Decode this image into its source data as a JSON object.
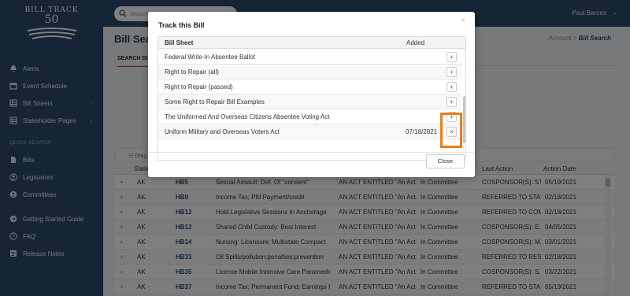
{
  "app": {
    "logo_top": "BILL TRACK",
    "logo_num": "50",
    "user_name": "Paul Barnes",
    "search_placeholder": "Search"
  },
  "sidebar": {
    "items": [
      {
        "label": "Alerts",
        "icon": "bell-icon"
      },
      {
        "label": "Event Schedule",
        "icon": "calendar-icon"
      },
      {
        "label": "Bill Sheets",
        "icon": "grid-icon",
        "chevron": "‹"
      },
      {
        "label": "Stakeholder Pages",
        "icon": "grid-icon",
        "chevron": "‹"
      }
    ],
    "quick_search_label": "QUICK SEARCH",
    "quick_items": [
      {
        "label": "Bills",
        "icon": "document-icon"
      },
      {
        "label": "Legislators",
        "icon": "person-icon"
      },
      {
        "label": "Committees",
        "icon": "group-icon"
      }
    ],
    "bottom_items": [
      {
        "label": "Getting Started Guide",
        "icon": "arrow-circle-icon"
      },
      {
        "label": "FAQ",
        "icon": "question-icon"
      },
      {
        "label": "Release Notes",
        "icon": "notes-icon"
      }
    ]
  },
  "page": {
    "title": "Bill Sea",
    "breadcrumb_parent": "Account",
    "breadcrumb_sep": " > ",
    "breadcrumb_current": "Bill Search",
    "tab_label": "SEARCH BIL",
    "group_bar_text": "Drag he"
  },
  "grid": {
    "headers": {
      "state": "State",
      "last_action": "Last Action",
      "action_date": "Action Date"
    },
    "rows": [
      {
        "state": "AK",
        "bill": "HB5",
        "title": "Sexual Assault; Def. Of \"consent\"",
        "desc": "AN ACT ENTITLED \"An Act r...",
        "status": "In Committee",
        "last": "COSPONSOR(S): ST...",
        "date": "05/19/2021"
      },
      {
        "state": "AK",
        "bill": "HB9",
        "title": "Income Tax; Pfd Payment/credit",
        "desc": "AN ACT ENTITLED \"An Act r...",
        "status": "In Committee",
        "last": "REFERRED TO STA...",
        "date": "02/18/2021"
      },
      {
        "state": "AK",
        "bill": "HB12",
        "title": "Hold Legislative Sessions In Anchorage",
        "desc": "AN ACT ENTITLED \"An Act r...",
        "status": "In Committee",
        "last": "REFERRED TO COM...",
        "date": "02/18/2021"
      },
      {
        "state": "AK",
        "bill": "HB13",
        "title": "Shared Child Custody: Best Interest",
        "desc": "AN ACT ENTITLED \"An Act r...",
        "status": "In Committee",
        "last": "COSPONSOR(S): E...",
        "date": "04/05/2021"
      },
      {
        "state": "AK",
        "bill": "HB14",
        "title": "Nursing: Licensure; Multistate Compact",
        "desc": "AN ACT ENTITLED \"An Act r...",
        "status": "In Committee",
        "last": "COSPONSOR(S): M...",
        "date": "03/01/2021"
      },
      {
        "state": "AK",
        "bill": "HB33",
        "title": "Oil Spills/pollution;penalties;prevention",
        "desc": "AN ACT ENTITLED \"An Act r...",
        "status": "In Committee",
        "last": "REFERRED TO RES...",
        "date": "02/18/2021"
      },
      {
        "state": "AK",
        "bill": "HB35",
        "title": "License Mobile Intensive Care Paramedics",
        "desc": "AN ACT ENTITLED \"An Act r...",
        "status": "In Committee",
        "last": "COSPONSOR(S): S...",
        "date": "03/22/2021"
      },
      {
        "state": "AK",
        "bill": "HB37",
        "title": "Income Tax; Permanent Fund; Earnings Res.",
        "desc": "AN ACT ENTITLED \"An Act r...",
        "status": "In Committee",
        "last": "REFERRED TO STA...",
        "date": "05/19/2021"
      }
    ]
  },
  "modal": {
    "title": "Track this Bill",
    "col_sheet": "Bill Sheet",
    "col_added": "Added",
    "rows": [
      {
        "name": "Federal Write-In Absentee Ballot",
        "added": "",
        "action": "+"
      },
      {
        "name": "Right to Repair (all)",
        "added": "",
        "action": "+"
      },
      {
        "name": "Right to Repair (passed)",
        "added": "",
        "action": "+"
      },
      {
        "name": "Some Right to Repair Bill Examples",
        "added": "",
        "action": "+"
      },
      {
        "name": "The Uniformed And Overseas Citizens Absentee Voting Act",
        "added": "",
        "action": "+"
      },
      {
        "name": "Uniform Military and Overseas Voters Act",
        "added": "07/18/2021",
        "action": "×"
      }
    ],
    "close_label": "Close",
    "close_x": "×"
  },
  "colors": {
    "sidebar": "#2b4a6c",
    "highlight": "#f07c1e"
  }
}
